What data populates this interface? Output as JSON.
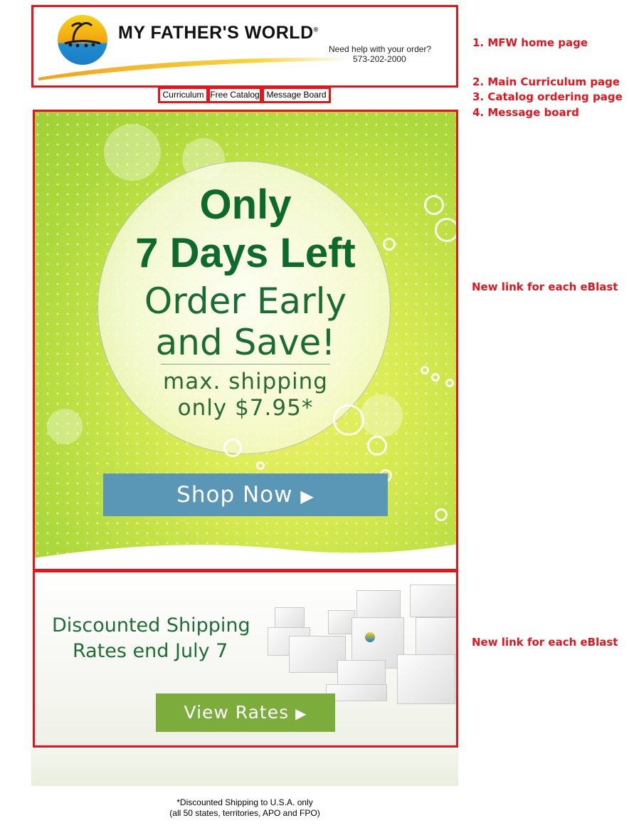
{
  "header": {
    "logo_text": "MY FATHER'S WORLD",
    "logo_mark": "®",
    "help_text": "Need help with your order?",
    "phone": "573-202-2000"
  },
  "nav": {
    "items": [
      {
        "label": "Curriculum"
      },
      {
        "label": "Free Catalog"
      },
      {
        "label": "Message Board"
      }
    ]
  },
  "annotations": {
    "home": "1. MFW home page",
    "curriculum": "2. Main Curriculum page",
    "catalog": "3. Catalog ordering page",
    "board": "4. Message board",
    "hero_link": "New link for each eBlast",
    "ship_link": "New link for each eBlast"
  },
  "hero": {
    "line1": "Only",
    "line2": "7 Days Left",
    "line3": "Order Early",
    "line4": "and Save!",
    "line5": "max. shipping",
    "line6": "only $7.95*",
    "button_label": "Shop Now",
    "button_arrow": "▶"
  },
  "shipping": {
    "line1": "Discounted Shipping",
    "line2": "Rates end July 7",
    "button_label": "View Rates",
    "button_arrow": "▶"
  },
  "footer": {
    "line1": "*Discounted Shipping to U.S.A. only",
    "line2": "(all 50 states, territories, APO and FPO)"
  },
  "colors": {
    "annotation_red": "#e8141c",
    "hero_green_text": "#0d6a2c",
    "shop_button": "#5a97b6",
    "rates_button": "#7bac3c"
  }
}
